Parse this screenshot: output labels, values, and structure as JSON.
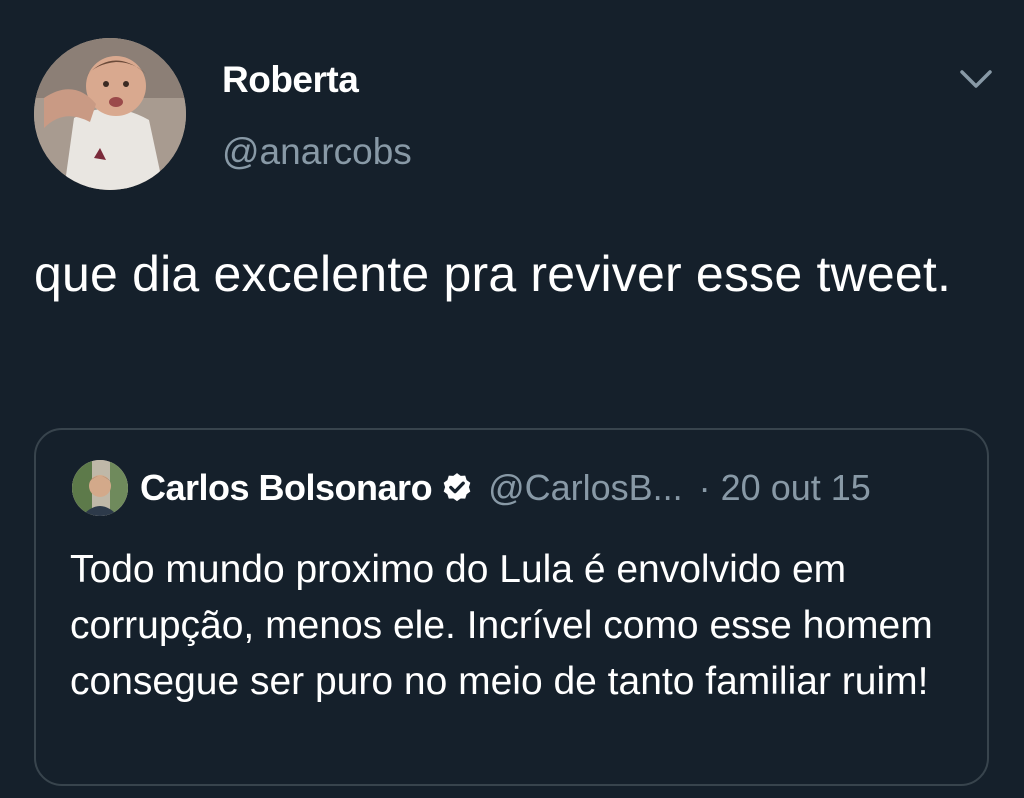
{
  "tweet": {
    "author": {
      "display_name": "Roberta",
      "handle": "@anarcobs"
    },
    "text": "que dia excelente pra reviver esse tweet.",
    "menu_icon": "chevron-down-icon"
  },
  "quoted_tweet": {
    "author": {
      "display_name": "Carlos Bolsonaro",
      "handle": "@CarlosB...",
      "verified_icon": "verified-badge-icon"
    },
    "separator": "·",
    "date": "20 out 15",
    "text": "Todo mundo proximo do Lula é envolvido em corrupção, menos ele. Incrível como esse homem consegue ser puro no meio de tanto familiar ruim!"
  },
  "colors": {
    "background": "#15202b",
    "primary_text": "#ffffff",
    "secondary_text": "#8899a6",
    "border": "#38444d"
  }
}
